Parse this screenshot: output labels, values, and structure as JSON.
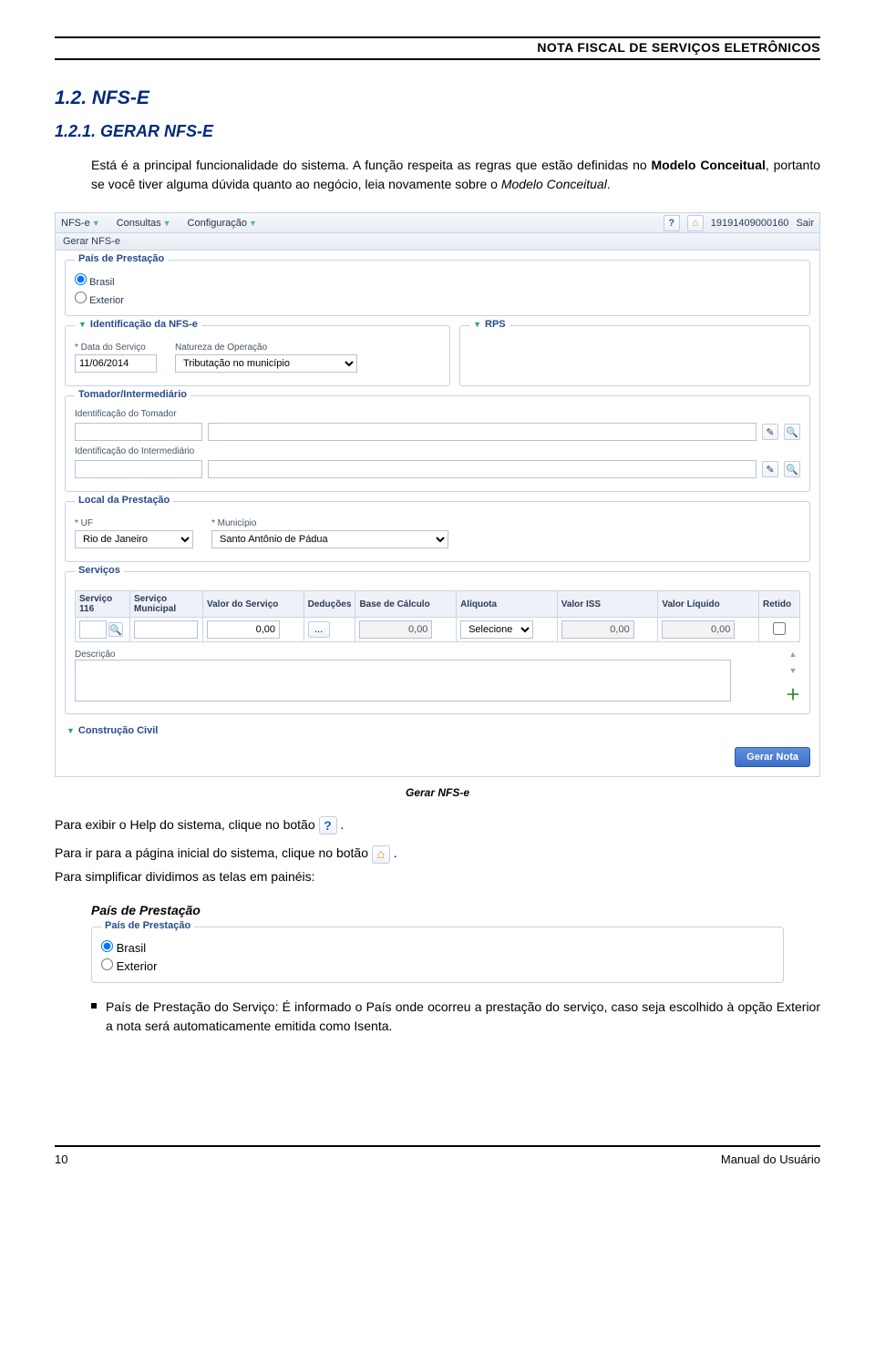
{
  "header": {
    "title": "NOTA FISCAL DE SERVIÇOS ELETRÔNICOS"
  },
  "section": {
    "num_title": "1.2.  NFS-E",
    "sub_title": "1.2.1.  GERAR NFS-E"
  },
  "intro": {
    "p1a": "Está é a principal funcionalidade do sistema. A função respeita as regras que estão definidas no ",
    "p1b": "Modelo Conceitual",
    "p1c": ", portanto se você tiver alguma dúvida quanto ao negócio, leia novamente sobre o ",
    "p1d": "Modelo Conceitual",
    "p1e": "."
  },
  "screenshot": {
    "menu": {
      "nfse": "NFS-e",
      "consultas": "Consultas",
      "config": "Configuração"
    },
    "topright": {
      "user": "19191409000160",
      "sair": "Sair"
    },
    "crumb": "Gerar NFS-e",
    "pais": {
      "title": "País de Prestação",
      "brasil": "Brasil",
      "exterior": "Exterior"
    },
    "ident": {
      "title": "Identificação da NFS-e",
      "data_lbl": "* Data do Serviço",
      "data_val": "11/06/2014",
      "nat_lbl": "Natureza de Operação",
      "nat_val": "Tributação no município"
    },
    "rps": {
      "title": "RPS"
    },
    "tomador_panel": {
      "title": "Tomador/Intermediário",
      "tomador_lbl": "Identificação do Tomador",
      "inter_lbl": "Identificação do Intermediário"
    },
    "local": {
      "title": "Local da Prestação",
      "uf_lbl": "* UF",
      "uf_val": "Rio de Janeiro",
      "mun_lbl": "* Município",
      "mun_val": "Santo Antônio de Pádua"
    },
    "servicos": {
      "title": "Serviços",
      "cols": {
        "c1": "Serviço 116",
        "c2": "Serviço Municipal",
        "c3": "Valor do Serviço",
        "c4": "Deduções",
        "c5": "Base de Cálculo",
        "c6": "Alíquota",
        "c7": "Valor ISS",
        "c8": "Valor Líquido",
        "c9": "Retido"
      },
      "row": {
        "valor": "0,00",
        "deducoes_btn": "...",
        "base": "0,00",
        "aliquota": "Selecione",
        "iss": "0,00",
        "liquido": "0,00"
      },
      "descr_lbl": "Descrição"
    },
    "construcao": "Construção Civil",
    "gerar_btn": "Gerar Nota"
  },
  "caption": "Gerar NFS-e",
  "after": {
    "p2a": "Para exibir o Help do sistema, clique no ",
    "p2b": "botão",
    "p2c": " .",
    "p3a": "Para ir para a página inicial do sistema, clique no ",
    "p3b": "botão",
    "p3c": " .",
    "p4": "Para simplificar dividimos as telas em painéis:",
    "h4": "País de Prestação"
  },
  "mini": {
    "title": "País de Prestação",
    "brasil": "Brasil",
    "exterior": "Exterior"
  },
  "bullet": {
    "lead": "País de Prestação do Serviço:",
    "rest": " É informado o País onde ocorreu a prestação do serviço, caso seja escolhido à opção Exterior a nota será automaticamente emitida como Isenta."
  },
  "footer": {
    "page": "10",
    "manual": "Manual do Usuário"
  }
}
